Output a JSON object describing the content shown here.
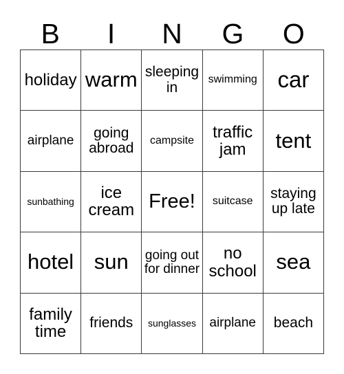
{
  "card": {
    "title_letters": [
      "B",
      "I",
      "N",
      "G",
      "O"
    ],
    "rows": [
      [
        {
          "text": "holiday",
          "size": "fs-md"
        },
        {
          "text": "warm",
          "size": "fs-xl"
        },
        {
          "text": "sleeping in",
          "size": "fs-sm"
        },
        {
          "text": "swimming",
          "size": "fs-xxs"
        },
        {
          "text": "car",
          "size": "fs-xxl"
        }
      ],
      [
        {
          "text": "airplane",
          "size": "fs-xs"
        },
        {
          "text": "going abroad",
          "size": "fs-sm"
        },
        {
          "text": "campsite",
          "size": "fs-xxs"
        },
        {
          "text": "traffic jam",
          "size": "fs-md"
        },
        {
          "text": "tent",
          "size": "fs-xl"
        }
      ],
      [
        {
          "text": "sunbathing",
          "size": "fs-tiny"
        },
        {
          "text": "ice cream",
          "size": "fs-md"
        },
        {
          "text": "Free!",
          "size": "fs-lg"
        },
        {
          "text": "suitcase",
          "size": "fs-xxs"
        },
        {
          "text": "staying up late",
          "size": "fs-sm"
        }
      ],
      [
        {
          "text": "hotel",
          "size": "fs-xl"
        },
        {
          "text": "sun",
          "size": "fs-xl"
        },
        {
          "text": "going out for dinner",
          "size": "fs-xs"
        },
        {
          "text": "no school",
          "size": "fs-md"
        },
        {
          "text": "sea",
          "size": "fs-xl"
        }
      ],
      [
        {
          "text": "family time",
          "size": "fs-md"
        },
        {
          "text": "friends",
          "size": "fs-sm"
        },
        {
          "text": "sunglasses",
          "size": "fs-tiny"
        },
        {
          "text": "airplane",
          "size": "fs-xs"
        },
        {
          "text": "beach",
          "size": "fs-sm"
        }
      ]
    ]
  },
  "colors": {
    "background": "#ffffff",
    "text": "#000000",
    "border": "#3a3a3a"
  }
}
